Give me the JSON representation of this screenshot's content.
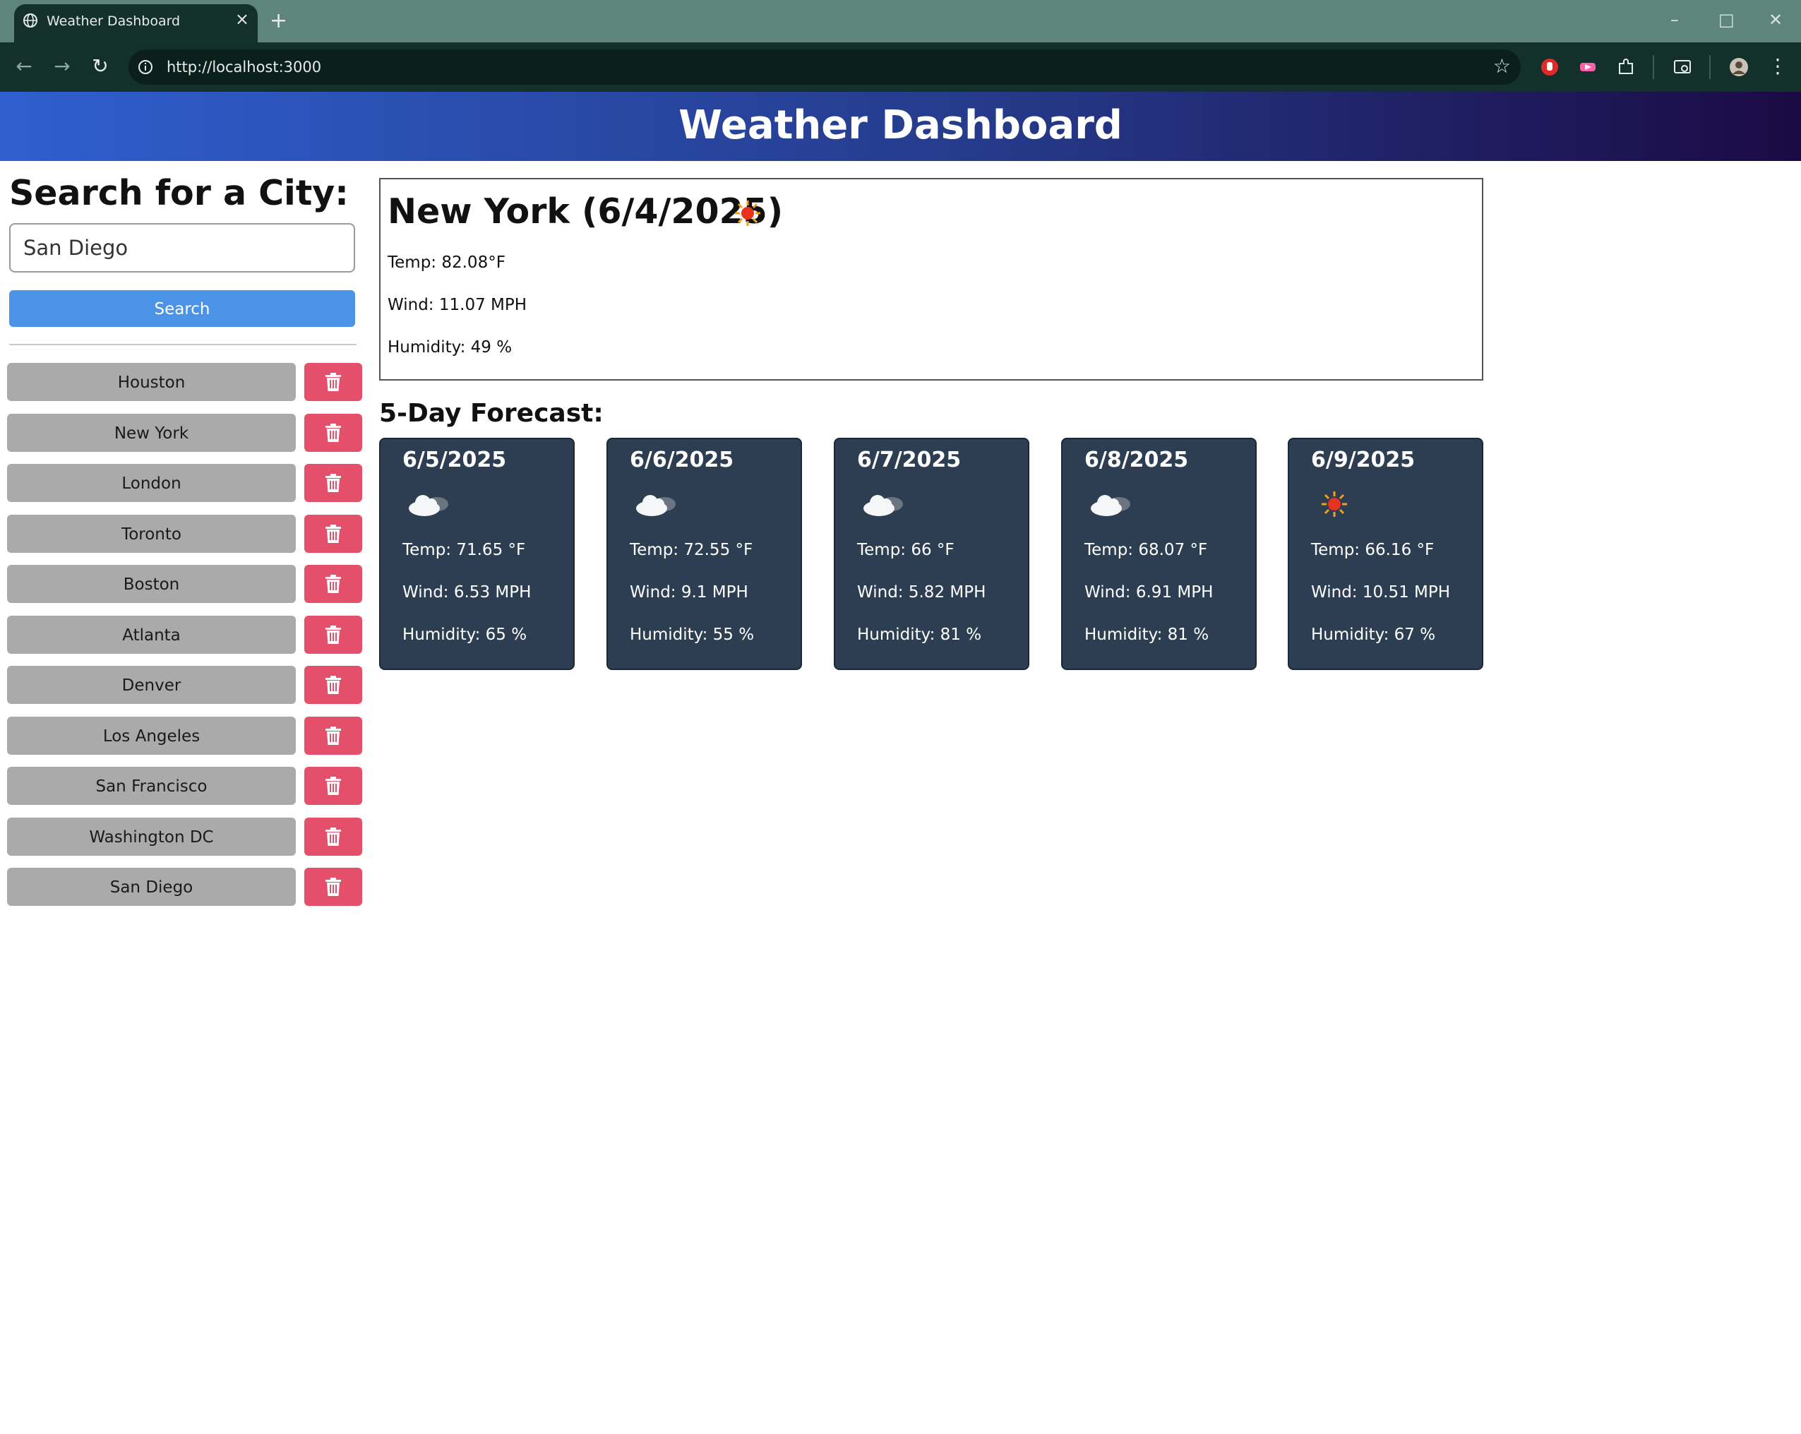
{
  "browser": {
    "tab_title": "Weather Dashboard",
    "tab_close": "×",
    "new_tab": "+",
    "url": "http://localhost:3000"
  },
  "header": {
    "title": "Weather Dashboard"
  },
  "search": {
    "heading": "Search for a City:",
    "input_value": "San Diego",
    "button_label": "Search"
  },
  "history": [
    {
      "city": "Houston"
    },
    {
      "city": "New York"
    },
    {
      "city": "London"
    },
    {
      "city": "Toronto"
    },
    {
      "city": "Boston"
    },
    {
      "city": "Atlanta"
    },
    {
      "city": "Denver"
    },
    {
      "city": "Los Angeles"
    },
    {
      "city": "San Francisco"
    },
    {
      "city": "Washington DC"
    },
    {
      "city": "San Diego"
    }
  ],
  "today": {
    "title": "New York (6/4/2025)",
    "icon": "sun-icon",
    "temp": "Temp: 82.08°F",
    "wind": "Wind: 11.07 MPH",
    "humidity": "Humidity: 49 %"
  },
  "forecast": {
    "heading": "5-Day Forecast:",
    "days": [
      {
        "date": "6/5/2025",
        "icon": "cloud-icon",
        "temp": "Temp: 71.65 °F",
        "wind": "Wind: 6.53 MPH",
        "humidity": "Humidity: 65 %"
      },
      {
        "date": "6/6/2025",
        "icon": "cloud-icon",
        "temp": "Temp: 72.55 °F",
        "wind": "Wind: 9.1 MPH",
        "humidity": "Humidity: 55 %"
      },
      {
        "date": "6/7/2025",
        "icon": "cloud-icon",
        "temp": "Temp: 66 °F",
        "wind": "Wind: 5.82 MPH",
        "humidity": "Humidity: 81 %"
      },
      {
        "date": "6/8/2025",
        "icon": "cloud-icon",
        "temp": "Temp: 68.07 °F",
        "wind": "Wind: 6.91 MPH",
        "humidity": "Humidity: 81 %"
      },
      {
        "date": "6/9/2025",
        "icon": "sun-icon",
        "temp": "Temp: 66.16 °F",
        "wind": "Wind: 10.51 MPH",
        "humidity": "Humidity: 67 %"
      }
    ]
  },
  "colors": {
    "header_gradient_start": "#2f5fcf",
    "header_gradient_end": "#1b0a44",
    "search_button": "#4a93e6",
    "city_button": "#aaaaaa",
    "delete_button": "#e4506a",
    "forecast_card": "#2d3e52"
  }
}
